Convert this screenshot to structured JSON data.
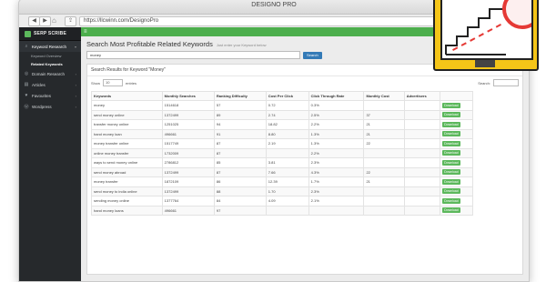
{
  "window": {
    "title": "DESIGNO PRO"
  },
  "browser": {
    "url": "https://llcwinn.com/DesignoPro",
    "back_icon": "back-arrow-icon",
    "forward_icon": "forward-arrow-icon",
    "share_icon": "share-icon"
  },
  "sidebar": {
    "brand": "SERP SCRIBE",
    "items": [
      {
        "label": "Keyword Research",
        "icon": "search-icon",
        "open": true,
        "children": [
          "Keyword Overview",
          "Related Keywords"
        ],
        "active_child": 1
      },
      {
        "label": "Domain Research",
        "icon": "globe-icon"
      },
      {
        "label": "Articles",
        "icon": "document-icon"
      },
      {
        "label": "Favourites",
        "icon": "heart-icon"
      },
      {
        "label": "Wordpress",
        "icon": "wordpress-icon"
      }
    ]
  },
  "main": {
    "title": "Search Most Profitable Related Keywords",
    "hint": "Just enter your Keyword below",
    "search_value": "money",
    "search_button": "Search",
    "results_title": "Search Results for Keyword \"Money\"",
    "show_label": "Show",
    "show_value": "10",
    "entries_label": "entries",
    "search_label": "Search:",
    "table": {
      "headers": [
        "Keywords",
        "Monthly Searches",
        "Ranking Difficulty",
        "Cost Per Click",
        "Click Through Rate",
        "Monthly Cost",
        "Advertisers",
        ""
      ],
      "rows": [
        [
          "money",
          "1514618",
          "57",
          "0.72",
          "0.3%",
          "",
          "",
          "Download"
        ],
        [
          "send money online",
          "1372499",
          "89",
          "2.74",
          "2.5%",
          "37",
          "",
          "Download"
        ],
        [
          "transfer money online",
          "1251025",
          "94",
          "18.82",
          "2.2%",
          "21",
          "",
          "Download"
        ],
        [
          "hand money loan",
          "496661",
          "91",
          "8.80",
          "1.3%",
          "21",
          "",
          "Download"
        ],
        [
          "money transfer online",
          "1517749",
          "87",
          "2.19",
          "1.3%",
          "22",
          "",
          "Download"
        ],
        [
          "online money transfer",
          "1732009",
          "87",
          "",
          "2.2%",
          "",
          "",
          "Download"
        ],
        [
          "ways to send money online",
          "2786812",
          "85",
          "3.81",
          "2.3%",
          "",
          "",
          "Download"
        ],
        [
          "send money abroad",
          "1372499",
          "87",
          "7.66",
          "4.3%",
          "22",
          "",
          "Download"
        ],
        [
          "money transfer",
          "1872109",
          "86",
          "12.39",
          "1.7%",
          "21",
          "",
          "Download"
        ],
        [
          "send money to india online",
          "1372499",
          "88",
          "1.70",
          "2.3%",
          "",
          "",
          "Download"
        ],
        [
          "sending money online",
          "1377764",
          "84",
          "4.09",
          "2.1%",
          "",
          "",
          "Download"
        ],
        [
          "hand money loans",
          "496661",
          "97",
          "",
          "",
          "",
          "",
          "Download"
        ]
      ]
    }
  },
  "colors": {
    "accent_green": "#4cae4c",
    "sidebar_dark": "#26292c",
    "button_blue": "#337ab7",
    "illustration_yellow": "#f5c518",
    "illustration_red": "#e53935"
  }
}
